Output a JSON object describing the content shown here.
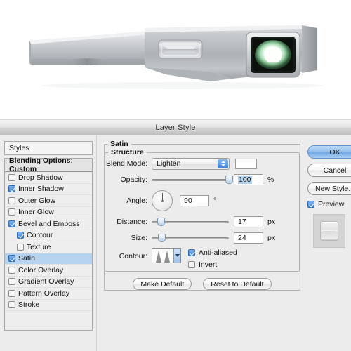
{
  "render": {
    "description": "metallic-device-3d-render",
    "lens_glow_color": "#e9fff0",
    "body_color": "#b9bcc0"
  },
  "dialog": {
    "title": "Layer Style",
    "styles_header": "Styles",
    "blending_options": "Blending Options: Custom",
    "effects": [
      {
        "label": "Drop Shadow",
        "checked": false,
        "indent": false,
        "selected": false
      },
      {
        "label": "Inner Shadow",
        "checked": true,
        "indent": false,
        "selected": false
      },
      {
        "label": "Outer Glow",
        "checked": false,
        "indent": false,
        "selected": false
      },
      {
        "label": "Inner Glow",
        "checked": false,
        "indent": false,
        "selected": false
      },
      {
        "label": "Bevel and Emboss",
        "checked": true,
        "indent": false,
        "selected": false
      },
      {
        "label": "Contour",
        "checked": true,
        "indent": true,
        "selected": false
      },
      {
        "label": "Texture",
        "checked": false,
        "indent": true,
        "selected": false
      },
      {
        "label": "Satin",
        "checked": true,
        "indent": false,
        "selected": true
      },
      {
        "label": "Color Overlay",
        "checked": false,
        "indent": false,
        "selected": false
      },
      {
        "label": "Gradient Overlay",
        "checked": false,
        "indent": false,
        "selected": false
      },
      {
        "label": "Pattern Overlay",
        "checked": false,
        "indent": false,
        "selected": false
      },
      {
        "label": "Stroke",
        "checked": false,
        "indent": false,
        "selected": false
      }
    ],
    "satin": {
      "group_title": "Satin",
      "structure_title": "Structure",
      "blend_mode_label": "Blend Mode:",
      "blend_mode_value": "Lighten",
      "blend_color": "#ffffff",
      "opacity_label": "Opacity:",
      "opacity_value": "100",
      "opacity_unit": "%",
      "angle_label": "Angle:",
      "angle_value": "90",
      "angle_unit": "°",
      "distance_label": "Distance:",
      "distance_value": "17",
      "distance_unit": "px",
      "size_label": "Size:",
      "size_value": "24",
      "size_unit": "px",
      "contour_label": "Contour:",
      "anti_aliased_label": "Anti-aliased",
      "anti_aliased_checked": true,
      "invert_label": "Invert",
      "invert_checked": false
    },
    "footer": {
      "make_default": "Make Default",
      "reset_to_default": "Reset to Default"
    },
    "side_buttons": {
      "ok": "OK",
      "cancel": "Cancel",
      "new_style": "New Style...",
      "preview_label": "Preview",
      "preview_checked": true
    }
  },
  "colors": {
    "accent_blue": "#3d82d6",
    "selection_blue": "#b6d4f0",
    "panel_gray": "#ececec"
  }
}
